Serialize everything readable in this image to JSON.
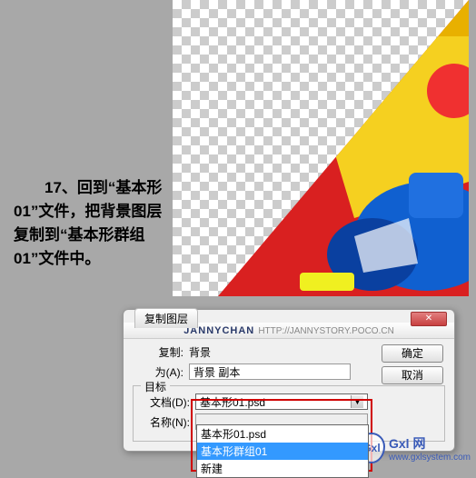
{
  "instruction": "　　17、回到“基本形01”文件，把背景图层复制到“基本形群组01”文件中。",
  "dialog": {
    "title": "复制图层",
    "close_glyph": "✕",
    "banner_brand": "JANNYCHAN",
    "banner_url": "HTTP://JANNYSTORY.POCO.CN",
    "copy": {
      "label": "复制:",
      "value": "背景"
    },
    "as": {
      "label": "为(A):",
      "value": "背景 副本"
    },
    "target": {
      "legend": "目标",
      "document": {
        "label": "文档(D):",
        "selected": "基本形01.psd",
        "options": [
          "基本形01.psd",
          "基本形群组01",
          "新建"
        ]
      },
      "name": {
        "label": "名称(N):",
        "value": ""
      }
    },
    "buttons": {
      "ok": "确定",
      "cancel": "取消"
    }
  },
  "watermark": {
    "badge": "Gxl",
    "brand": "Gxl 网",
    "url": "www.gxlsystem.com"
  }
}
